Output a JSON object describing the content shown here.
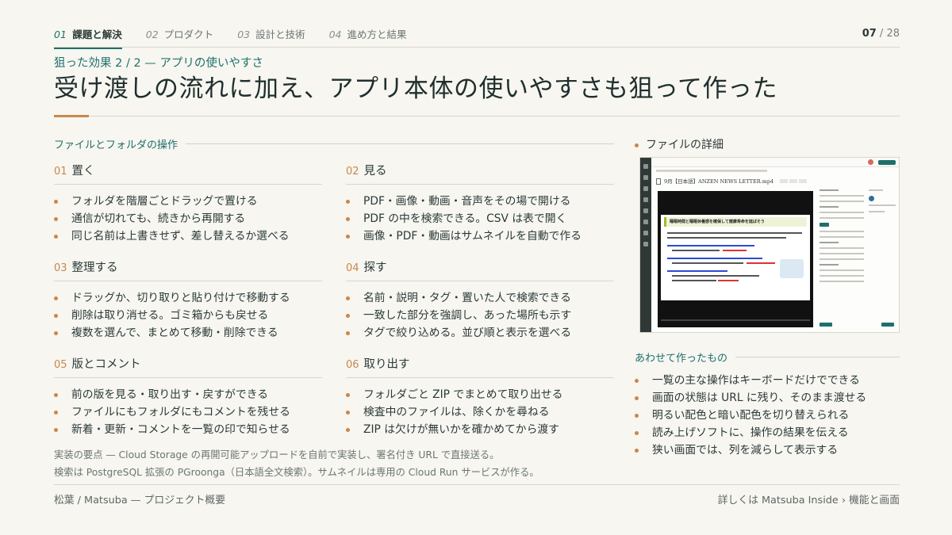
{
  "nav": {
    "tabs": [
      {
        "num": "01",
        "label": "課題と解決",
        "active": true
      },
      {
        "num": "02",
        "label": "プロダクト",
        "active": false
      },
      {
        "num": "03",
        "label": "設計と技術",
        "active": false
      },
      {
        "num": "04",
        "label": "進め方と結果",
        "active": false
      }
    ],
    "page_current": "07",
    "page_sep": "/",
    "page_total": "28"
  },
  "kicker": "狙った効果 2 / 2 — アプリの使いやすさ",
  "title": "受け渡しの流れに加え、アプリ本体の使いやすさも狙って作った",
  "section_left": "ファイルとフォルダの操作",
  "columns": [
    {
      "num": "01",
      "title": "置く",
      "items": [
        "フォルダを階層ごとドラッグで置ける",
        "通信が切れても、続きから再開する",
        "同じ名前は上書きせず、差し替えるか選べる"
      ]
    },
    {
      "num": "02",
      "title": "見る",
      "items": [
        "PDF・画像・動画・音声をその場で開ける",
        "PDF の中を検索できる。CSV は表で開く",
        "画像・PDF・動画はサムネイルを自動で作る"
      ]
    },
    {
      "num": "03",
      "title": "整理する",
      "items": [
        "ドラッグか、切り取りと貼り付けで移動する",
        "削除は取り消せる。ゴミ箱からも戻せる",
        "複数を選んで、まとめて移動・削除できる"
      ]
    },
    {
      "num": "04",
      "title": "探す",
      "items": [
        "名前・説明・タグ・置いた人で検索できる",
        "一致した部分を強調し、あった場所も示す",
        "タグで絞り込める。並び順と表示を選べる"
      ]
    },
    {
      "num": "05",
      "title": "版とコメント",
      "items": [
        "前の版を見る・取り出す・戻すができる",
        "ファイルにもフォルダにもコメントを残せる",
        "新着・更新・コメントを一覧の印で知らせる"
      ]
    },
    {
      "num": "06",
      "title": "取り出す",
      "items": [
        "フォルダごと ZIP でまとめて取り出せる",
        "検査中のファイルは、除くかを尋ねる",
        "ZIP は欠けが無いかを確かめてから渡す"
      ]
    }
  ],
  "notes": [
    "実装の要点 — Cloud Storage の再開可能アップロードを自前で実装し、署名付き URL で直接送る。",
    "検索は PostgreSQL 拡張の PGroonga（日本語全文検索）。サムネイルは専用の Cloud Run サービスが作る。"
  ],
  "detail": {
    "heading": "ファイルの詳細",
    "screenshot": {
      "file_name": "9月【日本語】ANZEN NEWS LETTER.mp4",
      "slide_title": "睡眠時間と睡眠休養感を確保して健康寿命を延ばそう"
    }
  },
  "made": {
    "heading": "あわせて作ったもの",
    "items": [
      "一覧の主な操作はキーボードだけでできる",
      "画面の状態は URL に残り、そのまま渡せる",
      "明るい配色と暗い配色を切り替えられる",
      "読み上げソフトに、操作の結果を伝える",
      "狭い画面では、列を減らして表示する"
    ]
  },
  "footer": {
    "left": "松葉 / Matsuba — プロジェクト概要",
    "right": "詳しくは Matsuba Inside › 機能と画面"
  },
  "colors": {
    "accent": "#1f6f6a",
    "bullet": "#c9874a",
    "background": "#f7f6f1"
  }
}
